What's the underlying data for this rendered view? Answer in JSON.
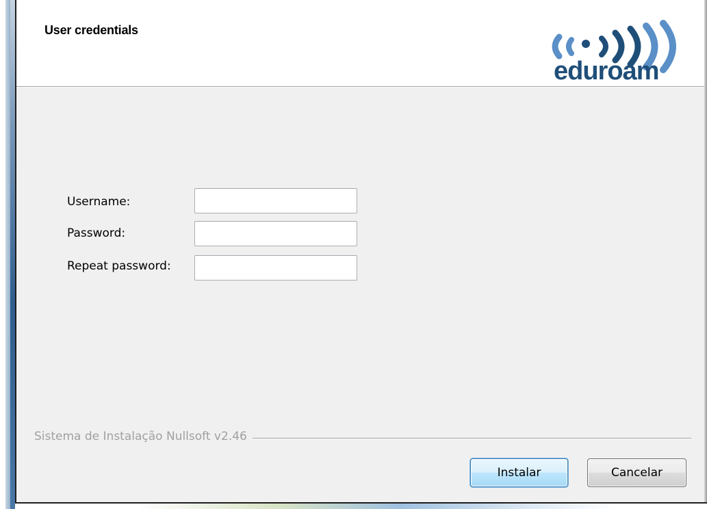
{
  "header": {
    "title": "User credentials",
    "logo_text": "eduroam",
    "logo_colors": {
      "dark": "#1f4e79",
      "light": "#5a8fc7"
    }
  },
  "form": {
    "fields": [
      {
        "label": "Username:",
        "value": "",
        "type": "text"
      },
      {
        "label": "Password:",
        "value": "",
        "type": "password"
      },
      {
        "label": "Repeat password:",
        "value": "",
        "type": "password"
      }
    ]
  },
  "footer": {
    "branding": "Sistema de Instalação Nullsoft v2.46"
  },
  "buttons": {
    "install_label": "Instalar",
    "cancel_label": "Cancelar"
  }
}
